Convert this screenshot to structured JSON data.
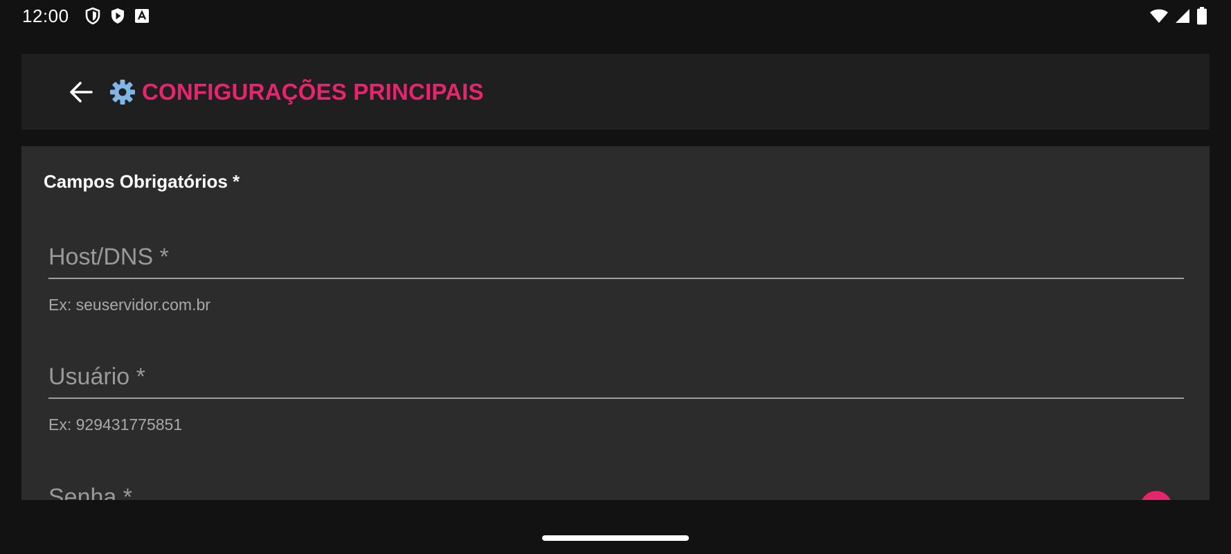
{
  "status_bar": {
    "time": "12:00",
    "icons": [
      "shield-icon",
      "play-icon",
      "font-icon",
      "wifi-icon",
      "signal-icon",
      "battery-icon"
    ]
  },
  "app_bar": {
    "back_icon": "arrow-left-icon",
    "title_icon": "gear-icon",
    "title": "CONFIGURAÇÕES PRINCIPAIS"
  },
  "form": {
    "section_title": "Campos Obrigatórios *",
    "host": {
      "placeholder": "Host/DNS *",
      "value": "",
      "helper": "Ex: seuservidor.com.br"
    },
    "user": {
      "placeholder": "Usuário *",
      "value": "",
      "helper": "Ex: 929431775851"
    },
    "password": {
      "placeholder": "Senha *",
      "value": "",
      "toggle_icon": "visibility-icon"
    }
  },
  "colors": {
    "accent": "#e8246f",
    "background": "#121212",
    "app_bar": "#1f1f1f",
    "card": "#2c2c2c"
  }
}
